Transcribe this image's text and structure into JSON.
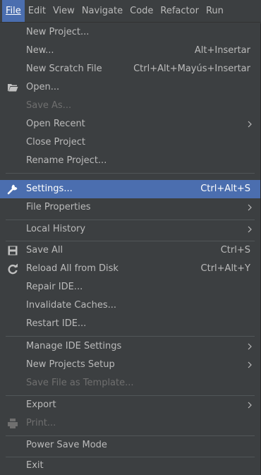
{
  "menubar": {
    "items": [
      {
        "label": "File"
      },
      {
        "label": "Edit"
      },
      {
        "label": "View"
      },
      {
        "label": "Navigate"
      },
      {
        "label": "Code"
      },
      {
        "label": "Refactor"
      },
      {
        "label": "Run"
      }
    ]
  },
  "file_menu": {
    "items": [
      {
        "label": "New Project...",
        "shortcut": ""
      },
      {
        "label": "New...",
        "shortcut": "Alt+Insertar"
      },
      {
        "label": "New Scratch File",
        "shortcut": "Ctrl+Alt+Mayús+Insertar"
      },
      {
        "label": "Open...",
        "shortcut": "",
        "icon": "folder-icon"
      },
      {
        "label": "Save As...",
        "shortcut": "",
        "disabled": true
      },
      {
        "label": "Open Recent",
        "submenu": true
      },
      {
        "label": "Close Project",
        "shortcut": ""
      },
      {
        "label": "Rename Project...",
        "shortcut": ""
      },
      {
        "label": "Settings...",
        "shortcut": "Ctrl+Alt+S",
        "icon": "wrench-icon",
        "selected": true
      },
      {
        "label": "File Properties",
        "submenu": true
      },
      {
        "label": "Local History",
        "submenu": true
      },
      {
        "label": "Save All",
        "shortcut": "Ctrl+S",
        "icon": "save-icon"
      },
      {
        "label": "Reload All from Disk",
        "shortcut": "Ctrl+Alt+Y",
        "icon": "reload-icon"
      },
      {
        "label": "Repair IDE...",
        "shortcut": ""
      },
      {
        "label": "Invalidate Caches...",
        "shortcut": ""
      },
      {
        "label": "Restart IDE...",
        "shortcut": ""
      },
      {
        "label": "Manage IDE Settings",
        "submenu": true
      },
      {
        "label": "New Projects Setup",
        "submenu": true
      },
      {
        "label": "Save File as Template...",
        "disabled": true
      },
      {
        "label": "Export",
        "submenu": true
      },
      {
        "label": "Print...",
        "disabled": true,
        "icon": "print-icon"
      },
      {
        "label": "Power Save Mode",
        "shortcut": ""
      },
      {
        "label": "Exit",
        "shortcut": ""
      }
    ]
  },
  "colors": {
    "background": "#3c3f41",
    "selection": "#4b6eaf",
    "text": "#bbbbbb",
    "disabled_text": "#6f6f6f"
  }
}
